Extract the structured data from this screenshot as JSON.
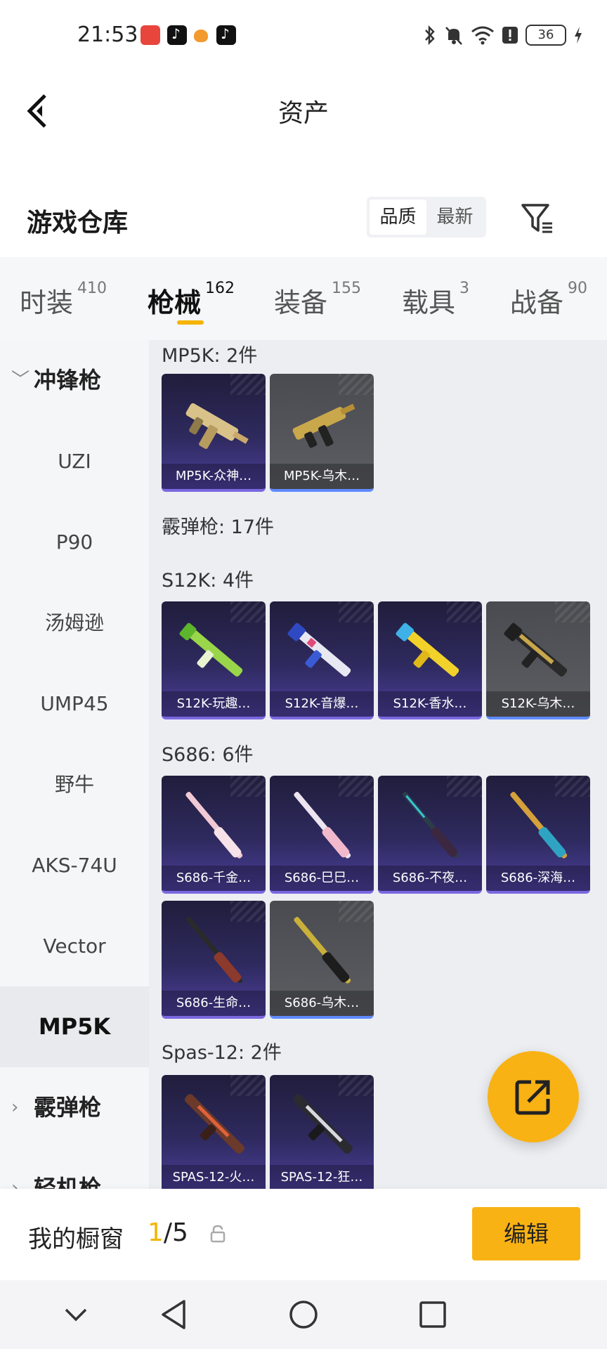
{
  "status_bar": {
    "time": "21:53",
    "battery": "36",
    "icons": [
      "bluetooth-icon",
      "mute-icon",
      "wifi-icon",
      "alert-icon",
      "battery-icon",
      "charging-icon"
    ]
  },
  "header": {
    "title": "资产"
  },
  "warehouse": {
    "title": "游戏仓库",
    "sort_options": [
      "品质",
      "最新"
    ],
    "sort_selected": "品质"
  },
  "tabs": [
    {
      "label": "时装",
      "count": "410"
    },
    {
      "label": "枪械",
      "count": "162",
      "active": true
    },
    {
      "label": "装备",
      "count": "155"
    },
    {
      "label": "载具",
      "count": "3"
    },
    {
      "label": "战备",
      "count": "90"
    }
  ],
  "sidebar": {
    "items": [
      {
        "label": "冲锋枪",
        "type": "group",
        "expanded": true
      },
      {
        "label": "UZI"
      },
      {
        "label": "P90"
      },
      {
        "label": "汤姆逊"
      },
      {
        "label": "UMP45"
      },
      {
        "label": "野牛"
      },
      {
        "label": "AKS-74U"
      },
      {
        "label": "Vector"
      },
      {
        "label": "MP5K",
        "active": true
      },
      {
        "label": "霰弹枪",
        "type": "group",
        "expanded": false
      },
      {
        "label": "轻机枪",
        "type": "group",
        "expanded": false
      }
    ]
  },
  "content": {
    "sections": [
      {
        "label": "MP5K: 2件",
        "items": [
          {
            "name": "MP5K-众神…",
            "style": "purple"
          },
          {
            "name": "MP5K-乌木…",
            "style": "gray"
          }
        ]
      },
      {
        "label": "霰弹枪: 17件",
        "items": []
      },
      {
        "label": "S12K: 4件",
        "items": [
          {
            "name": "S12K-玩趣…",
            "style": "purple"
          },
          {
            "name": "S12K-音爆…",
            "style": "purple"
          },
          {
            "name": "S12K-香水…",
            "style": "purple"
          },
          {
            "name": "S12K-乌木…",
            "style": "gray"
          }
        ]
      },
      {
        "label": "S686: 6件",
        "items": [
          {
            "name": "S686-千金…",
            "style": "purple"
          },
          {
            "name": "S686-巳巳…",
            "style": "purple"
          },
          {
            "name": "S686-不夜…",
            "style": "purple"
          },
          {
            "name": "S686-深海…",
            "style": "purple"
          },
          {
            "name": "S686-生命…",
            "style": "purple"
          },
          {
            "name": "S686-乌木…",
            "style": "gray"
          }
        ]
      },
      {
        "label": "Spas-12: 2件",
        "items": [
          {
            "name": "SPAS-12-火…",
            "style": "purple"
          },
          {
            "name": "SPAS-12-狂…",
            "style": "purple"
          }
        ]
      }
    ]
  },
  "showcase": {
    "label": "我的橱窗",
    "current": "1",
    "total": "/5",
    "edit_label": "编辑"
  },
  "colors": {
    "accent": "#f9b214",
    "card_purple": "#2e2a5e",
    "card_gray": "#5d5e63"
  }
}
